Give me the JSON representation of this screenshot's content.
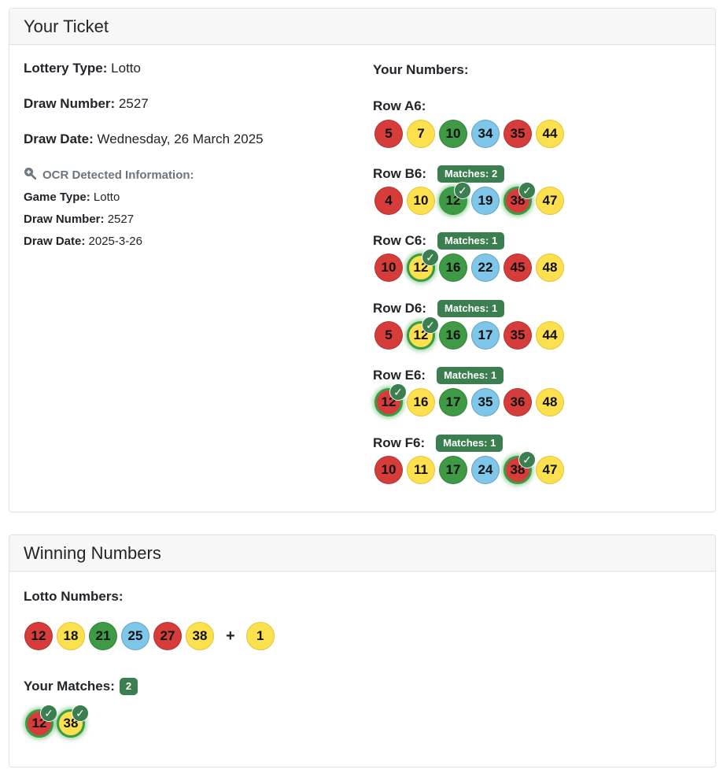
{
  "ticket": {
    "header": "Your Ticket",
    "lottery_type_label": "Lottery Type:",
    "lottery_type": "Lotto",
    "draw_number_label": "Draw Number:",
    "draw_number": "2527",
    "draw_date_label": "Draw Date:",
    "draw_date": "Wednesday, 26 March 2025",
    "ocr": {
      "title": "OCR Detected Information:",
      "game_type_label": "Game Type:",
      "game_type": "Lotto",
      "draw_number_label": "Draw Number:",
      "draw_number": "2527",
      "draw_date_label": "Draw Date:",
      "draw_date": "2025-3-26"
    },
    "your_numbers_label": "Your Numbers:",
    "rows": [
      {
        "name": "Row A6:",
        "badge": "",
        "balls": [
          {
            "n": "5",
            "c": "red",
            "m": false
          },
          {
            "n": "7",
            "c": "yellow",
            "m": false
          },
          {
            "n": "10",
            "c": "green",
            "m": false
          },
          {
            "n": "34",
            "c": "blue",
            "m": false
          },
          {
            "n": "35",
            "c": "red",
            "m": false
          },
          {
            "n": "44",
            "c": "yellow",
            "m": false
          }
        ]
      },
      {
        "name": "Row B6:",
        "badge": "Matches: 2",
        "balls": [
          {
            "n": "4",
            "c": "red",
            "m": false
          },
          {
            "n": "10",
            "c": "yellow",
            "m": false
          },
          {
            "n": "12",
            "c": "green",
            "m": true
          },
          {
            "n": "19",
            "c": "blue",
            "m": false
          },
          {
            "n": "38",
            "c": "red",
            "m": true
          },
          {
            "n": "47",
            "c": "yellow",
            "m": false
          }
        ]
      },
      {
        "name": "Row C6:",
        "badge": "Matches: 1",
        "balls": [
          {
            "n": "10",
            "c": "red",
            "m": false
          },
          {
            "n": "12",
            "c": "yellow",
            "m": true
          },
          {
            "n": "16",
            "c": "green",
            "m": false
          },
          {
            "n": "22",
            "c": "blue",
            "m": false
          },
          {
            "n": "45",
            "c": "red",
            "m": false
          },
          {
            "n": "48",
            "c": "yellow",
            "m": false
          }
        ]
      },
      {
        "name": "Row D6:",
        "badge": "Matches: 1",
        "balls": [
          {
            "n": "5",
            "c": "red",
            "m": false
          },
          {
            "n": "12",
            "c": "yellow",
            "m": true
          },
          {
            "n": "16",
            "c": "green",
            "m": false
          },
          {
            "n": "17",
            "c": "blue",
            "m": false
          },
          {
            "n": "35",
            "c": "red",
            "m": false
          },
          {
            "n": "44",
            "c": "yellow",
            "m": false
          }
        ]
      },
      {
        "name": "Row E6:",
        "badge": "Matches: 1",
        "balls": [
          {
            "n": "12",
            "c": "red",
            "m": true
          },
          {
            "n": "16",
            "c": "yellow",
            "m": false
          },
          {
            "n": "17",
            "c": "green",
            "m": false
          },
          {
            "n": "35",
            "c": "blue",
            "m": false
          },
          {
            "n": "36",
            "c": "red",
            "m": false
          },
          {
            "n": "48",
            "c": "yellow",
            "m": false
          }
        ]
      },
      {
        "name": "Row F6:",
        "badge": "Matches: 1",
        "balls": [
          {
            "n": "10",
            "c": "red",
            "m": false
          },
          {
            "n": "11",
            "c": "yellow",
            "m": false
          },
          {
            "n": "17",
            "c": "green",
            "m": false
          },
          {
            "n": "24",
            "c": "blue",
            "m": false
          },
          {
            "n": "38",
            "c": "red",
            "m": true
          },
          {
            "n": "47",
            "c": "yellow",
            "m": false
          }
        ]
      }
    ]
  },
  "winning": {
    "header": "Winning Numbers",
    "lotto_numbers_label": "Lotto Numbers:",
    "numbers": [
      {
        "n": "12",
        "c": "red"
      },
      {
        "n": "18",
        "c": "yellow"
      },
      {
        "n": "21",
        "c": "green"
      },
      {
        "n": "25",
        "c": "blue"
      },
      {
        "n": "27",
        "c": "red"
      },
      {
        "n": "38",
        "c": "yellow"
      }
    ],
    "plus": "+",
    "bonus": {
      "n": "1",
      "c": "yellow"
    },
    "your_matches_label": "Your Matches:",
    "match_count": "2",
    "matched": [
      {
        "n": "12",
        "c": "red"
      },
      {
        "n": "38",
        "c": "yellow"
      }
    ]
  },
  "icons": {
    "check": "✓",
    "ocr": "search-plus-icon"
  },
  "colors": {
    "accent": "#3b7e4f",
    "red": "#d63d3a",
    "yellow": "#fde04e",
    "green": "#3e9a45",
    "blue": "#7ec6ea"
  }
}
